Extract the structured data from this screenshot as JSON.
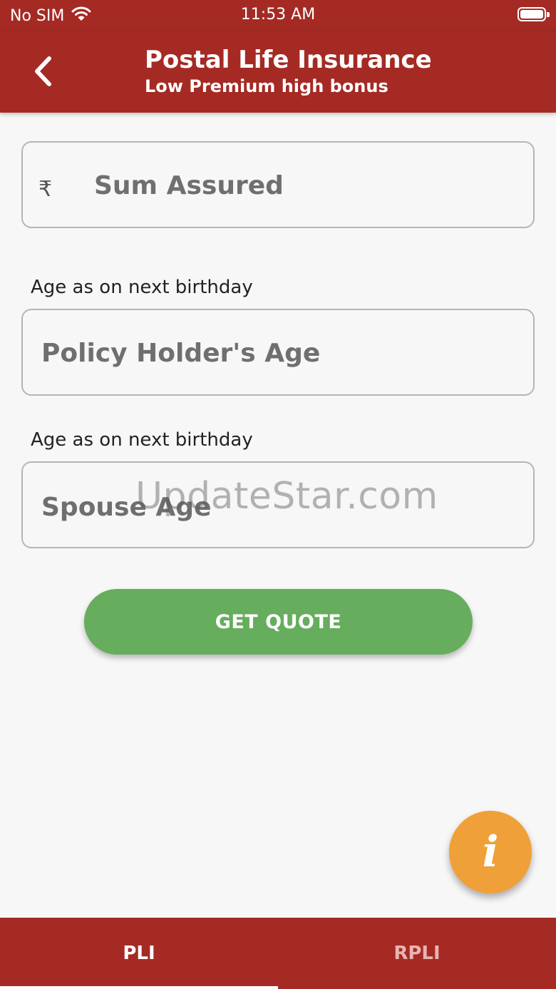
{
  "status_bar": {
    "carrier": "No SIM",
    "time": "11:53 AM"
  },
  "app_bar": {
    "title": "Postal Life Insurance",
    "subtitle": "Low Premium high bonus"
  },
  "form": {
    "sum_assured": {
      "currency_symbol": "₹",
      "placeholder": "Sum Assured",
      "value": ""
    },
    "holder_age": {
      "label": "Age as on next birthday",
      "placeholder": "Policy Holder's Age",
      "value": ""
    },
    "spouse_age": {
      "label": "Age as on next birthday",
      "placeholder": "Spouse Age",
      "value": ""
    },
    "submit_label": "GET QUOTE"
  },
  "watermark": "UpdateStar.com",
  "fab": {
    "label": "i"
  },
  "bottom_nav": {
    "tabs": [
      {
        "label": "PLI",
        "active": true
      },
      {
        "label": "RPLI",
        "active": false
      }
    ]
  },
  "colors": {
    "primary": "#a52a24",
    "button": "#66ad5d",
    "fab": "#f0a038",
    "background": "#f7f7f7"
  }
}
